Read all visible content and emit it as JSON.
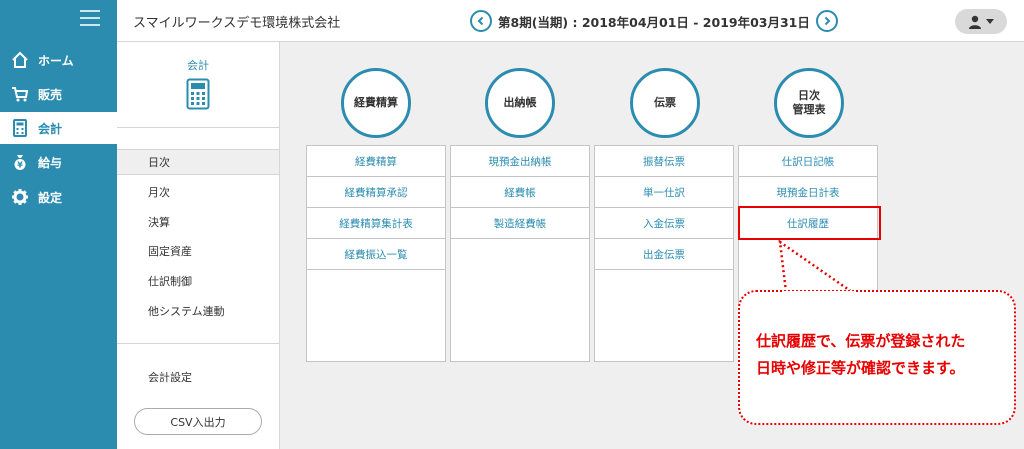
{
  "sidebar": {
    "items": [
      {
        "label": "ホーム",
        "icon": "home-icon"
      },
      {
        "label": "販売",
        "icon": "cart-icon"
      },
      {
        "label": "会計",
        "icon": "calculator-icon",
        "active": true
      },
      {
        "label": "給与",
        "icon": "money-bag-icon"
      },
      {
        "label": "設定",
        "icon": "gear-icon"
      }
    ]
  },
  "header": {
    "company": "スマイルワークスデモ環境株式会社",
    "period": "第8期(当期) : 2018年04月01日 - 2019年03月31日"
  },
  "submenu": {
    "title": "会計",
    "items": [
      "日次",
      "月次",
      "決算",
      "固定資産",
      "仕訳制御",
      "他システム連動"
    ],
    "settings": "会計設定",
    "csv_button": "CSV入出力"
  },
  "main": {
    "columns": [
      {
        "title": "経費精算",
        "items": [
          "経費精算",
          "経費精算承認",
          "経費精算集計表",
          "経費振込一覧"
        ]
      },
      {
        "title": "出納帳",
        "items": [
          "現預金出納帳",
          "経費帳",
          "製造経費帳"
        ]
      },
      {
        "title": "伝票",
        "items": [
          "振替伝票",
          "単一仕訳",
          "入金伝票",
          "出金伝票"
        ]
      },
      {
        "title_line1": "日次",
        "title_line2": "管理表",
        "items": [
          "仕訳日記帳",
          "現預金日計表",
          "仕訳履歴"
        ]
      }
    ]
  },
  "callout": {
    "line1": "仕訳履歴で、伝票が登録された",
    "line2": "日時や修正等が確認できます。"
  },
  "colors": {
    "accent": "#2b8cb0",
    "highlight": "#e60000"
  }
}
